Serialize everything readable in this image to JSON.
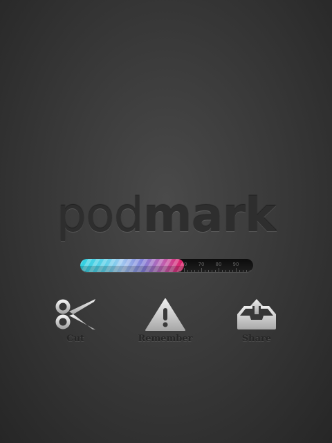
{
  "logo": {
    "part1": "pod",
    "part2": "mark"
  },
  "progress": {
    "percent": 60,
    "tick_labels": [
      "60",
      "70",
      "80",
      "90"
    ]
  },
  "actions": [
    {
      "label": "Cut",
      "icon": "scissors-icon"
    },
    {
      "label": "Remember",
      "icon": "warning-icon"
    },
    {
      "label": "Share",
      "icon": "inbox-upload-icon"
    }
  ]
}
